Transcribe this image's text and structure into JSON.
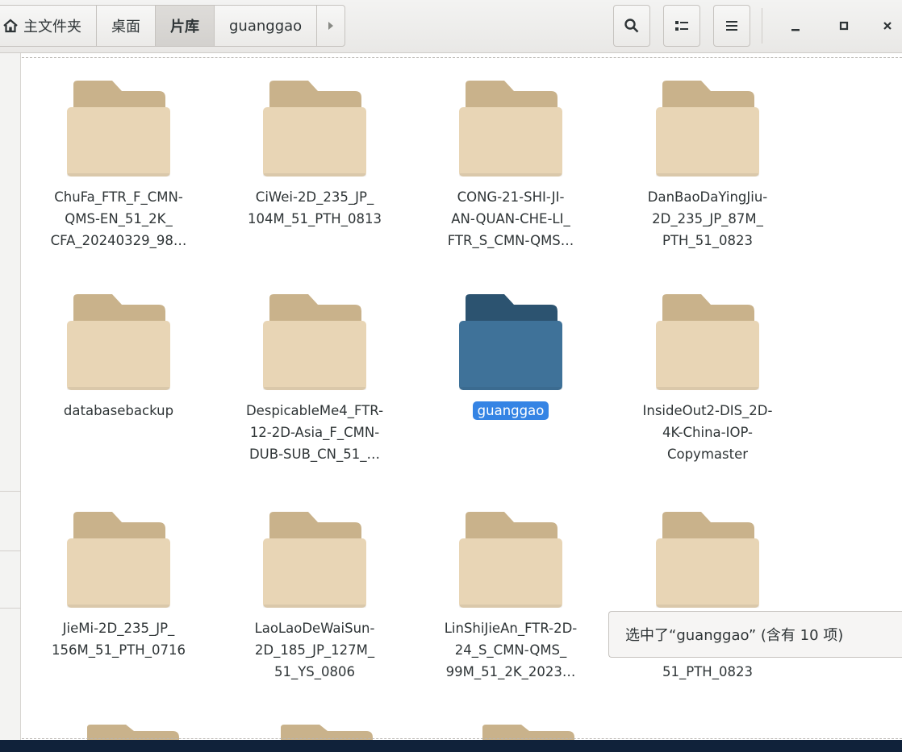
{
  "pathbar": {
    "home": "主文件夹",
    "items": [
      "桌面",
      "片库",
      "guanggao"
    ],
    "active_index": 1
  },
  "toolbar": {
    "search": "search-icon",
    "view_toggle": "view-options-icon",
    "menu": "hamburger-menu-icon"
  },
  "window": {
    "minimize": "minimize-icon",
    "maximize": "maximize-icon",
    "close": "close-icon"
  },
  "files": [
    {
      "name": "ChuFa_FTR_F_CMN-\nQMS-EN_51_2K_\nCFA_20240329_98…",
      "selected": false
    },
    {
      "name": "CiWei-2D_235_JP_\n104M_51_PTH_0813",
      "selected": false
    },
    {
      "name": "CONG-21-SHI-JI-\nAN-QUAN-CHE-LI_\nFTR_S_CMN-QMS…",
      "selected": false
    },
    {
      "name": "DanBaoDaYingJiu-\n2D_235_JP_87M_\nPTH_51_0823",
      "selected": false
    },
    {
      "name": "databasebackup",
      "selected": false
    },
    {
      "name": "DespicableMe4_FTR-\n12-2D-Asia_F_CMN-\nDUB-SUB_CN_51_…",
      "selected": false
    },
    {
      "name": "guanggao",
      "selected": true
    },
    {
      "name": "InsideOut2-DIS_2D-\n4K-China-IOP-\nCopymaster",
      "selected": false
    },
    {
      "name": "JieMi-2D_235_JP_\n156M_51_PTH_0716",
      "selected": false
    },
    {
      "name": "LaoLaoDeWaiSun-\n2D_185_JP_127M_\n51_YS_0806",
      "selected": false
    },
    {
      "name": "LinShiJieAn_FTR-2D-\n24_S_CMN-QMS_\n99M_51_2K_2023…",
      "selected": false
    },
    {
      "name": "LiSiBenWanChenMo-\n2D_185_JP_122M_\n51_PTH_0823",
      "selected": false
    }
  ],
  "status": "选中了“guanggao” (含有 10 项)",
  "colors": {
    "folder_body": "#e8d5b5",
    "folder_tab": "#c9b28b",
    "folder_selected_body": "#3f7299",
    "folder_selected_tab": "#2c5370",
    "selection": "#3584e4"
  }
}
